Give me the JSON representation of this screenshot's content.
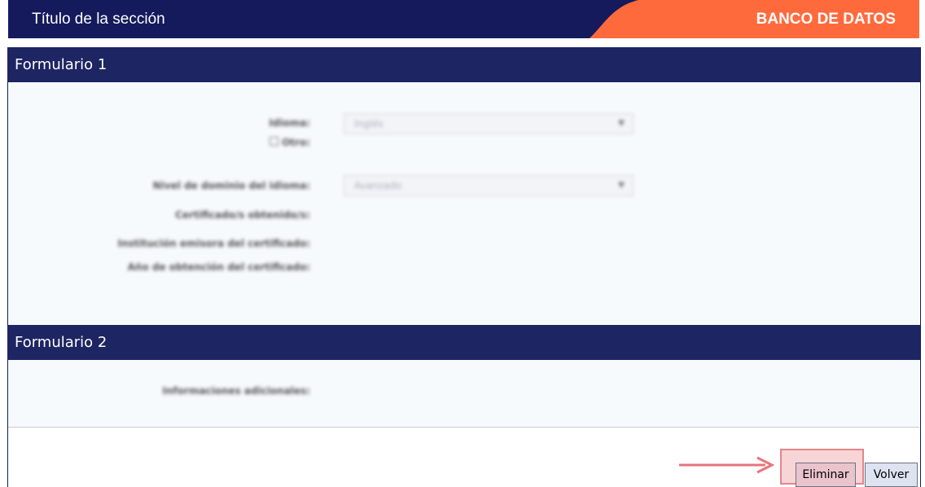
{
  "header": {
    "title": "Título de la sección",
    "brand": "BANCO DE DATOS",
    "accent": "#ff6a3d",
    "navy": "#141a5c"
  },
  "form1": {
    "heading": "Formulario 1",
    "fields": {
      "language_label": "Idioma:",
      "language_value": "Inglés",
      "other_label": "Otro:",
      "level_label": "Nivel de dominio del idioma:",
      "level_value": "Avanzado",
      "certificates_label": "Certificado/s obtenido/s:",
      "institution_label": "Institución emisora del certificado:",
      "year_label": "Año de obtención del certificado:"
    }
  },
  "form2": {
    "heading": "Formulario 2",
    "fields": {
      "additional_label": "Informaciones adicionales:"
    }
  },
  "actions": {
    "delete_label": "Eliminar",
    "back_label": "Volver"
  },
  "icons": {
    "dropdown": "chevron-down-icon",
    "annotation_arrow": "arrow-right-icon"
  }
}
